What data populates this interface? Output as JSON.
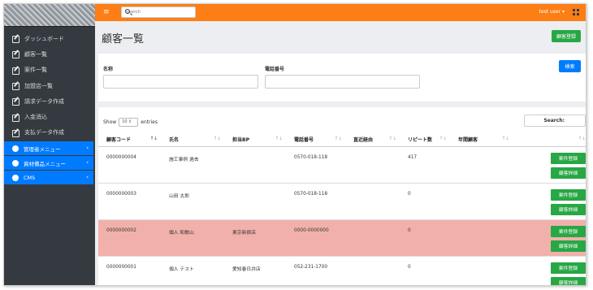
{
  "sidebar": {
    "items": [
      {
        "label": "ダッシュボード"
      },
      {
        "label": "顧客一覧"
      },
      {
        "label": "案件一覧"
      },
      {
        "label": "加盟店一覧"
      },
      {
        "label": "請求データ作成"
      },
      {
        "label": "入金消込"
      },
      {
        "label": "支払データ作成"
      }
    ],
    "groups": [
      {
        "label": "管理者メニュー"
      },
      {
        "label": "資材備品メニュー"
      },
      {
        "label": "CMS"
      }
    ]
  },
  "topbar": {
    "search_placeholder": "Search",
    "user": "test user ▾"
  },
  "page": {
    "title": "顧客一覧",
    "register_button": "顧客登録"
  },
  "filter": {
    "name_label": "名称",
    "phone_label": "電話番号",
    "search_button": "検索"
  },
  "table_controls": {
    "show_label": "Show",
    "page_size": "10",
    "entries_label": "entries",
    "search_label": "Search:"
  },
  "table": {
    "columns": [
      "顧客コード",
      "氏名",
      "担当BP",
      "電話番号",
      "直近経由",
      "リピート数",
      "年間顧客",
      ""
    ],
    "rows": [
      {
        "code": "0000000004",
        "name": "施工事例 過去",
        "bp": "",
        "phone": "0570-018-118",
        "via": "",
        "repeat": "417",
        "annual": "",
        "highlight": false
      },
      {
        "code": "0000000003",
        "name": "山田 太郎",
        "bp": "",
        "phone": "0570-018-118",
        "via": "",
        "repeat": "0",
        "annual": "",
        "highlight": false
      },
      {
        "code": "0000000002",
        "name": "個人 和歌山",
        "bp": "東京新宿店",
        "phone": "0000-0000000",
        "via": "",
        "repeat": "0",
        "annual": "",
        "highlight": true
      },
      {
        "code": "0000000001",
        "name": "個人 テスト",
        "bp": "愛知春日井店",
        "phone": "052-231-1700",
        "via": "",
        "repeat": "0",
        "annual": "",
        "highlight": false
      }
    ],
    "action_case": "案件登録",
    "action_detail": "顧客詳細"
  },
  "colors": {
    "topbar": "#fd7e14",
    "sidebar": "#343a40",
    "primary": "#007bff",
    "success": "#28a745",
    "highlight_row": "#f1b1aa"
  }
}
